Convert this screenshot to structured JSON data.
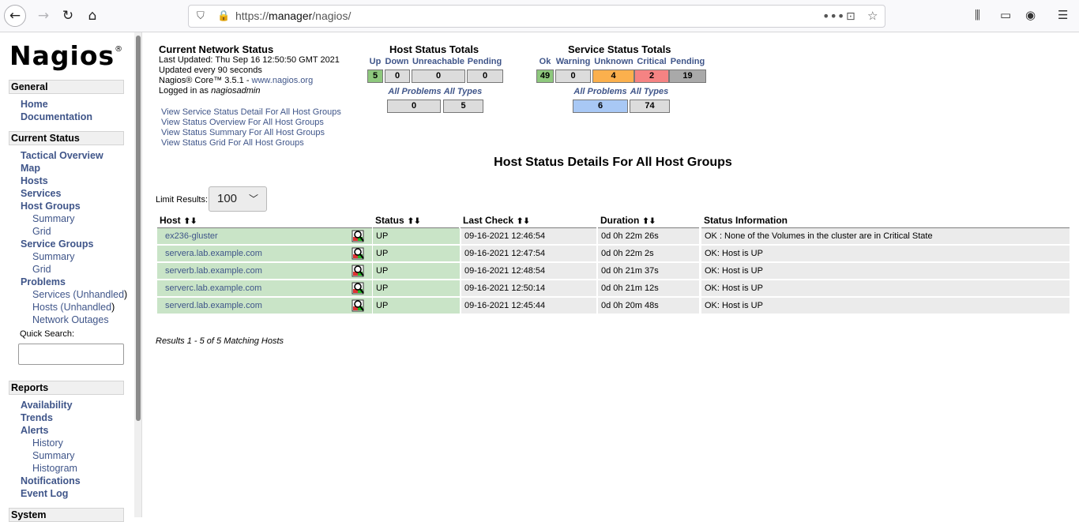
{
  "browser": {
    "url_prefix": "https://",
    "url_domain": "manager",
    "url_path": "/nagios/"
  },
  "sidebar": {
    "logo": "Nagios",
    "logo_mark": "®",
    "general": {
      "title": "General",
      "items": [
        "Home",
        "Documentation"
      ]
    },
    "current_status": {
      "title": "Current Status",
      "tactical": "Tactical Overview",
      "map": "Map",
      "hosts": "Hosts",
      "services": "Services",
      "host_groups": "Host Groups",
      "hg_summary": "Summary",
      "hg_grid": "Grid",
      "service_groups": "Service Groups",
      "sg_summary": "Summary",
      "sg_grid": "Grid",
      "problems": "Problems",
      "services_text": "Services (",
      "unhandled1": "Unhandled",
      "close1": ")",
      "hosts_text": "Hosts (",
      "unhandled2": "Unhandled",
      "close2": ")",
      "network_outages": "Network Outages",
      "quick_search": "Quick Search:"
    },
    "reports": {
      "title": "Reports",
      "availability": "Availability",
      "trends": "Trends",
      "alerts": "Alerts",
      "history": "History",
      "summary": "Summary",
      "histogram": "Histogram",
      "notifications": "Notifications",
      "event_log": "Event Log"
    },
    "system": {
      "title": "System"
    }
  },
  "network_status": {
    "title": "Current Network Status",
    "last_updated": "Last Updated: Thu Sep 16 12:50:50 GMT 2021",
    "update_interval": "Updated every 90 seconds",
    "version_text": "Nagios® Core™ 3.5.1 - ",
    "version_link": "www.nagios.org",
    "logged_in_prefix": "Logged in as ",
    "user": "nagiosadmin",
    "links": [
      "View Service Status Detail For All Host Groups",
      "View Status Overview For All Host Groups",
      "View Status Summary For All Host Groups",
      "View Status Grid For All Host Groups"
    ]
  },
  "host_totals": {
    "title": "Host Status Totals",
    "up_label": "Up",
    "down_label": "Down",
    "unreachable_label": "Unreachable",
    "pending_label": "Pending",
    "up": "5",
    "down": "0",
    "unreachable": "0",
    "pending": "0",
    "all_problems_label": "All Problems",
    "all_types_label": "All Types",
    "all_problems": "0",
    "all_types": "5",
    "colors": {
      "up": "#8ec87d",
      "neutral": "#dcdcdc"
    }
  },
  "service_totals": {
    "title": "Service Status Totals",
    "ok_label": "Ok",
    "warning_label": "Warning",
    "unknown_label": "Unknown",
    "critical_label": "Critical",
    "pending_label": "Pending",
    "ok": "49",
    "warning": "0",
    "unknown": "4",
    "critical": "2",
    "pending": "19",
    "all_problems_label": "All Problems",
    "all_types_label": "All Types",
    "all_problems": "6",
    "all_types": "74",
    "colors": {
      "ok": "#8ec87d",
      "unknown": "#fbb04d",
      "critical": "#f58383",
      "pending": "#a9a9a9",
      "problems": "#a8c8f5"
    }
  },
  "details": {
    "title": "Host Status Details For All Host Groups",
    "limit_label": "Limit Results:",
    "limit_value": "100",
    "columns": {
      "host": "Host",
      "status": "Status",
      "last_check": "Last Check",
      "duration": "Duration",
      "info": "Status Information"
    },
    "sort_arrows": "⬆⬇",
    "rows": [
      {
        "host": "ex236-gluster",
        "status": "UP",
        "last_check": "09-16-2021 12:46:54",
        "duration": "0d 0h 22m 26s",
        "info": "OK : None of the Volumes in the cluster are in Critical State"
      },
      {
        "host": "servera.lab.example.com",
        "status": "UP",
        "last_check": "09-16-2021 12:47:54",
        "duration": "0d 0h 22m 2s",
        "info": "OK: Host is UP"
      },
      {
        "host": "serverb.lab.example.com",
        "status": "UP",
        "last_check": "09-16-2021 12:48:54",
        "duration": "0d 0h 21m 37s",
        "info": "OK: Host is UP"
      },
      {
        "host": "serverc.lab.example.com",
        "status": "UP",
        "last_check": "09-16-2021 12:50:14",
        "duration": "0d 0h 21m 12s",
        "info": "OK: Host is UP"
      },
      {
        "host": "serverd.lab.example.com",
        "status": "UP",
        "last_check": "09-16-2021 12:45:44",
        "duration": "0d 0h 20m 48s",
        "info": "OK: Host is UP"
      }
    ],
    "results_text": "Results 1 - 5 of 5 Matching Hosts"
  }
}
